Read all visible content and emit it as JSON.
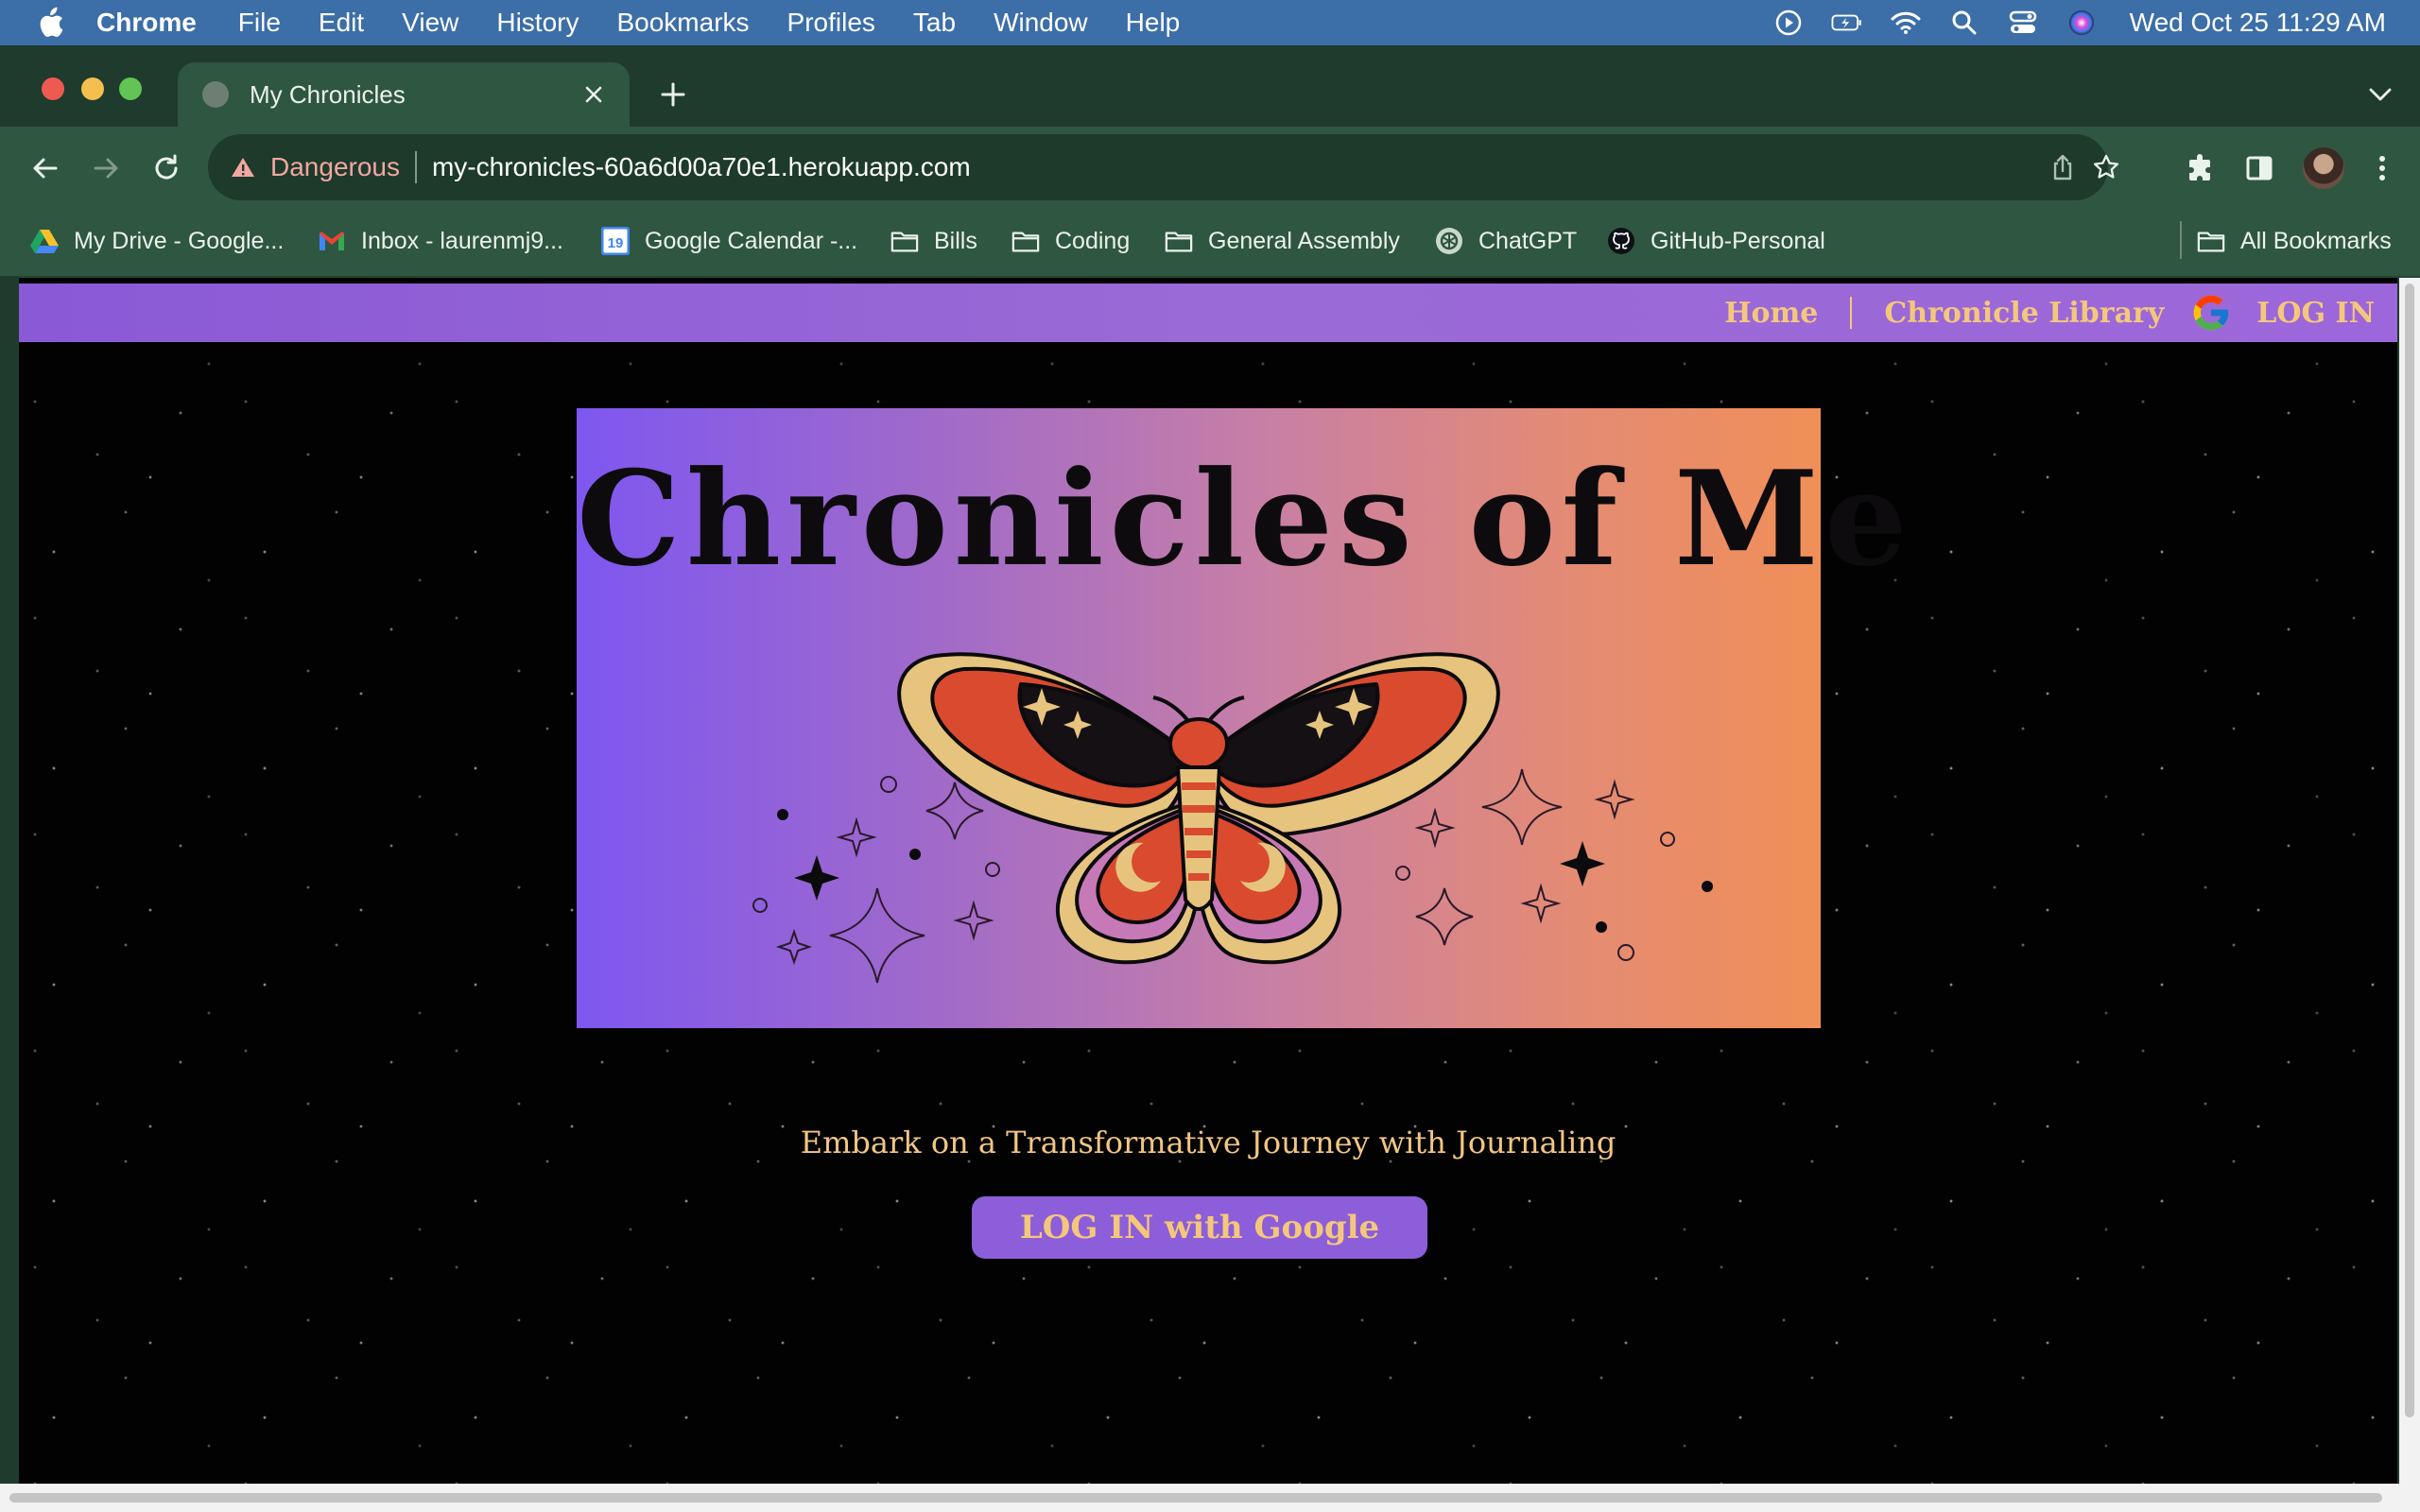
{
  "menubar": {
    "app": "Chrome",
    "items": [
      "File",
      "Edit",
      "View",
      "History",
      "Bookmarks",
      "Profiles",
      "Tab",
      "Window",
      "Help"
    ],
    "clock": "Wed Oct 25  11:29 AM"
  },
  "browser": {
    "tab_title": "My Chronicles",
    "security_label": "Dangerous",
    "url": "my-chronicles-60a6d00a70e1.herokuapp.com",
    "bookmarks": [
      "My Drive - Google...",
      "Inbox - laurenmj9...",
      "Google Calendar -...",
      "Bills",
      "Coding",
      "General Assembly",
      "ChatGPT",
      "GitHub-Personal"
    ],
    "all_bookmarks": "All Bookmarks",
    "calendar_badge": "19"
  },
  "site": {
    "nav": {
      "home": "Home",
      "library": "Chronicle Library",
      "login": "LOG IN"
    },
    "banner_title": "Chronicles of Me",
    "tagline": "Embark on a Transformative Journey with Journaling",
    "login_button": "LOG IN with Google"
  },
  "colors": {
    "nav_bar": "#9a6ad6",
    "nav_text": "#f4c77b",
    "banner_gradient_start": "#7e57f0",
    "banner_gradient_end": "#f08f57",
    "page_bg": "#020203",
    "chrome_toolbar": "#2f5640",
    "danger_text": "#f2a7a0"
  },
  "icons": {
    "menubar": [
      "apple-icon",
      "play-icon",
      "battery-icon",
      "wifi-icon",
      "spotlight-icon",
      "control-center-icon",
      "siri-icon"
    ],
    "toolbar": [
      "back-icon",
      "forward-icon",
      "reload-icon",
      "warning-icon",
      "share-icon",
      "star-icon",
      "extensions-icon",
      "sidepanel-icon",
      "avatar",
      "more-icon"
    ],
    "site": [
      "google-icon",
      "moth-illustration"
    ]
  }
}
